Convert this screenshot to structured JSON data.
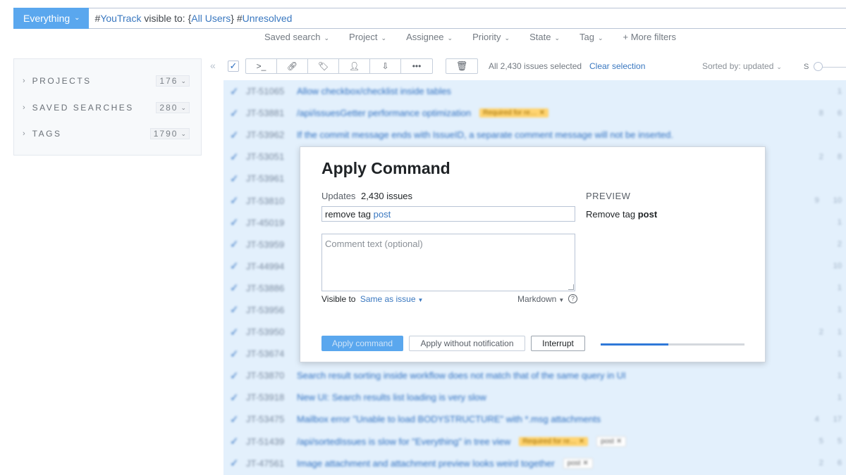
{
  "search": {
    "context_label": "Everything",
    "query_parts": [
      "#",
      "YouTrack",
      " visible to: {",
      "All Users",
      "} #",
      "Unresolved"
    ]
  },
  "filters": [
    "Saved search",
    "Project",
    "Assignee",
    "Priority",
    "State",
    "Tag"
  ],
  "more_filters": "+ More filters",
  "sidebar": {
    "items": [
      {
        "label": "PROJECTS",
        "count": "176"
      },
      {
        "label": "SAVED SEARCHES",
        "count": "280"
      },
      {
        "label": "TAGS",
        "count": "1790"
      }
    ]
  },
  "toolbar": {
    "selection_text": "All 2,430 issues selected",
    "clear_selection": "Clear selection",
    "sorted_by": "Sorted by: updated",
    "size_label": "S"
  },
  "issues": [
    {
      "id": "JT-51065",
      "summary": "Allow checkbox/checklist inside tables",
      "tags": [],
      "counts": [
        "1"
      ]
    },
    {
      "id": "JT-53881",
      "summary": "/api/issuesGetter performance optimization",
      "tags": [
        "Required for re… ✕"
      ],
      "counts": [
        "8",
        "6"
      ]
    },
    {
      "id": "JT-53962",
      "summary": "If the commit message ends with IssueID, a separate comment message will not be inserted.",
      "tags": [],
      "counts": [
        "1"
      ]
    },
    {
      "id": "JT-53051",
      "summary": "",
      "tags": [],
      "counts": [
        "2",
        "8"
      ]
    },
    {
      "id": "JT-53961",
      "summary": "",
      "tags": [],
      "counts": []
    },
    {
      "id": "JT-53810",
      "summary": "",
      "tags": [],
      "counts": [
        "9",
        "10"
      ]
    },
    {
      "id": "JT-45019",
      "summary": "",
      "tags": [],
      "counts": [
        "1"
      ]
    },
    {
      "id": "JT-53959",
      "summary": "",
      "tags": [],
      "counts": [
        "2"
      ]
    },
    {
      "id": "JT-44994",
      "summary": "",
      "tags": [],
      "counts": [
        "10"
      ]
    },
    {
      "id": "JT-53886",
      "summary": "",
      "tags": [],
      "counts": [
        "1"
      ]
    },
    {
      "id": "JT-53956",
      "summary": "",
      "tags": [],
      "counts": [
        "1"
      ]
    },
    {
      "id": "JT-53950",
      "summary": "",
      "tags": [],
      "counts": [
        "2",
        "1"
      ]
    },
    {
      "id": "JT-53674",
      "summary": "",
      "tags": [],
      "counts": [
        "1"
      ]
    },
    {
      "id": "JT-53870",
      "summary": "Search result sorting inside workflow does not match that of the same query in UI",
      "tags": [],
      "counts": [
        "1"
      ]
    },
    {
      "id": "JT-53918",
      "summary": "New UI: Search results list loading is very slow",
      "tags": [],
      "counts": [
        "1"
      ]
    },
    {
      "id": "JT-53475",
      "summary": "Mailbox error \"Unable to load BODYSTRUCTURE\" with *.msg attachments",
      "tags": [],
      "counts": [
        "4",
        "17"
      ]
    },
    {
      "id": "JT-51439",
      "summary": "/api/sortedIssues is slow for \"Everything\" in tree view",
      "tags": [
        "Required for re… ✕",
        "post ✕"
      ],
      "counts": [
        "5",
        "5"
      ]
    },
    {
      "id": "JT-47561",
      "summary": "Image attachment and attachment preview looks weird together",
      "tags": [
        "post ✕"
      ],
      "counts": [
        "2",
        "6"
      ]
    }
  ],
  "dialog": {
    "title": "Apply Command",
    "updates_label": "Updates",
    "updates_count": "2,430 issues",
    "command_prefix": "remove tag ",
    "command_value": "post",
    "comment_placeholder": "Comment text (optional)",
    "visible_to_label": "Visible to",
    "visible_to_value": "Same as issue",
    "markdown_label": "Markdown",
    "preview_label": "PREVIEW",
    "preview_prefix": "Remove tag ",
    "preview_value": "post",
    "apply_button": "Apply command",
    "apply_without_notification": "Apply without notification",
    "interrupt_button": "Interrupt",
    "progress": 0.47
  },
  "colors": {
    "accent": "#5aa7ee",
    "link": "#3a78c0",
    "selection_bg": "#e3f0fc",
    "tag_yellow": "#ffd470",
    "progress": "#2f78d8"
  }
}
